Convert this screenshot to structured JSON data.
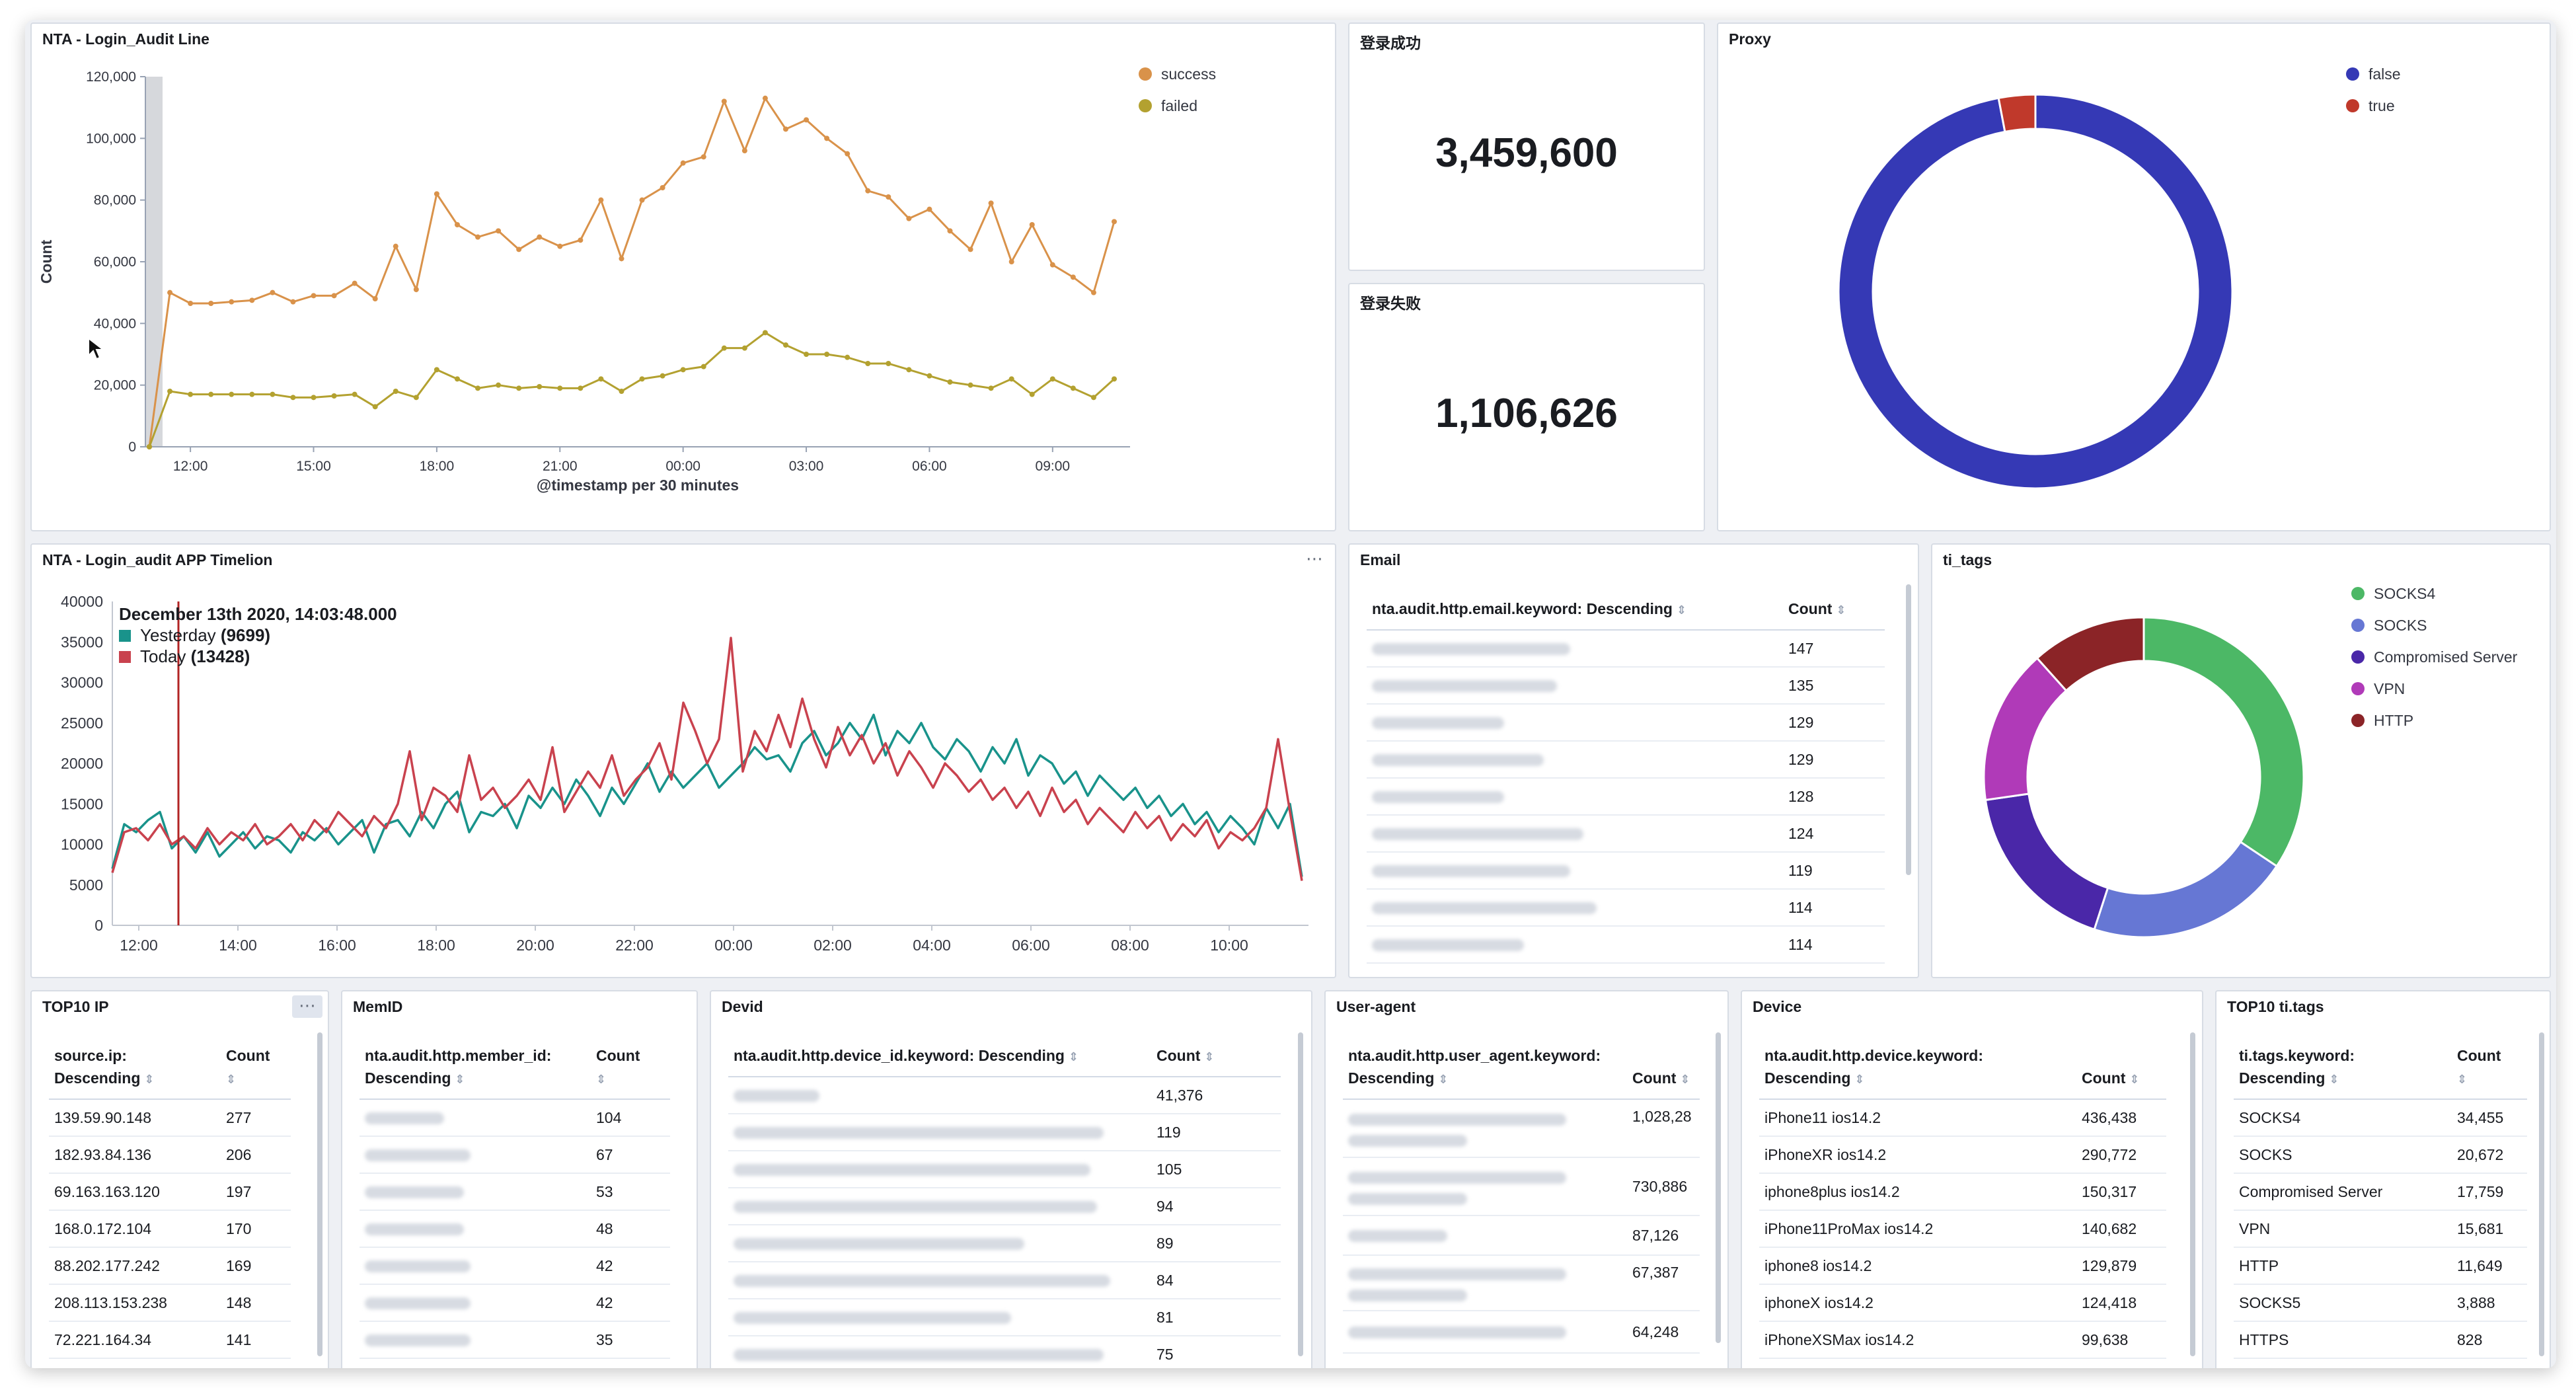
{
  "panels": {
    "login_line": {
      "title": "NTA - Login_Audit Line",
      "xlabel": "@timestamp per 30 minutes",
      "ylabel": "Count",
      "legend": [
        {
          "name": "success",
          "color": "#d9924a"
        },
        {
          "name": "failed",
          "color": "#b3a130"
        }
      ]
    },
    "success_metric": {
      "title": "登录成功",
      "value": "3,459,600"
    },
    "failed_metric": {
      "title": "登录失败",
      "value": "1,106,626"
    },
    "proxy": {
      "title": "Proxy",
      "legend": [
        {
          "name": "false",
          "color": "#3539b5"
        },
        {
          "name": "true",
          "color": "#c0392b"
        }
      ]
    },
    "timelion": {
      "title": "NTA - Login_audit APP Timelion",
      "tooltip": {
        "date": "December 13th 2020, 14:03:48.000",
        "rows": [
          {
            "label": "Yesterday",
            "value": "(9699)",
            "color": "#19938b"
          },
          {
            "label": "Today",
            "value": "(13428)",
            "color": "#c9424e"
          }
        ]
      }
    },
    "email": {
      "title": "Email",
      "col1": "nta.audit.http.email.keyword: Descending",
      "col2": "Count",
      "rows": [
        {
          "count": "147"
        },
        {
          "count": "135"
        },
        {
          "count": "129"
        },
        {
          "count": "129"
        },
        {
          "count": "128"
        },
        {
          "count": "124"
        },
        {
          "count": "119"
        },
        {
          "count": "114"
        },
        {
          "count": "114"
        }
      ]
    },
    "ti_tags": {
      "title": "ti_tags",
      "legend": [
        {
          "name": "SOCKS4",
          "color": "#4cb866"
        },
        {
          "name": "SOCKS",
          "color": "#6677d4"
        },
        {
          "name": "Compromised Server",
          "color": "#4a27a8"
        },
        {
          "name": "VPN",
          "color": "#b03ab8"
        },
        {
          "name": "HTTP",
          "color": "#8b2427"
        }
      ]
    },
    "top10_ip": {
      "title": "TOP10 IP",
      "col1": "source.ip: Descending",
      "col2": "Count",
      "rows": [
        {
          "key": "139.59.90.148",
          "count": "277"
        },
        {
          "key": "182.93.84.136",
          "count": "206"
        },
        {
          "key": "69.163.163.120",
          "count": "197"
        },
        {
          "key": "168.0.172.104",
          "count": "170"
        },
        {
          "key": "88.202.177.242",
          "count": "169"
        },
        {
          "key": "208.113.153.238",
          "count": "148"
        },
        {
          "key": "72.221.164.34",
          "count": "141"
        }
      ]
    },
    "memid": {
      "title": "MemID",
      "col1": "nta.audit.http.member_id: Descending",
      "col2": "Count",
      "rows": [
        {
          "count": "104"
        },
        {
          "count": "67"
        },
        {
          "count": "53"
        },
        {
          "count": "48"
        },
        {
          "count": "42"
        },
        {
          "count": "42"
        },
        {
          "count": "35"
        }
      ]
    },
    "devid": {
      "title": "Devid",
      "col1": "nta.audit.http.device_id.keyword: Descending",
      "col2": "Count",
      "rows": [
        {
          "count": "41,376"
        },
        {
          "count": "119"
        },
        {
          "count": "105"
        },
        {
          "count": "94"
        },
        {
          "count": "89"
        },
        {
          "count": "84"
        },
        {
          "count": "81"
        },
        {
          "count": "75"
        }
      ]
    },
    "useragent": {
      "title": "User-agent",
      "col1": "nta.audit.http.user_agent.keyword: Descending",
      "col2": "Count",
      "rows": [
        {
          "count": "1,028,28"
        },
        {
          "count": "730,886"
        },
        {
          "count": "87,126"
        },
        {
          "count": "67,387"
        },
        {
          "count": "64,248"
        }
      ]
    },
    "device": {
      "title": "Device",
      "col1": "nta.audit.http.device.keyword: Descending",
      "col2": "Count",
      "rows": [
        {
          "key": "iPhone11 ios14.2",
          "count": "436,438"
        },
        {
          "key": "iPhoneXR ios14.2",
          "count": "290,772"
        },
        {
          "key": "iphone8plus ios14.2",
          "count": "150,317"
        },
        {
          "key": "iPhone11ProMax ios14.2",
          "count": "140,682"
        },
        {
          "key": "iphone8 ios14.2",
          "count": "129,879"
        },
        {
          "key": "iphoneX ios14.2",
          "count": "124,418"
        },
        {
          "key": "iPhoneXSMax ios14.2",
          "count": "99,638"
        }
      ]
    },
    "top10_tags": {
      "title": "TOP10 ti.tags",
      "col1": "ti.tags.keyword: Descending",
      "col2": "Count",
      "rows": [
        {
          "key": "SOCKS4",
          "count": "34,455"
        },
        {
          "key": "SOCKS",
          "count": "20,672"
        },
        {
          "key": "Compromised Server",
          "count": "17,759"
        },
        {
          "key": "VPN",
          "count": "15,681"
        },
        {
          "key": "HTTP",
          "count": "11,649"
        },
        {
          "key": "SOCKS5",
          "count": "3,888"
        },
        {
          "key": "HTTPS",
          "count": "828"
        }
      ]
    }
  },
  "chart_data": [
    {
      "type": "line",
      "title": "NTA - Login_Audit Line",
      "xlabel": "@timestamp per 30 minutes",
      "ylabel": "Count",
      "ylim": [
        0,
        120000
      ],
      "x_ticks": [
        "12:00",
        "15:00",
        "18:00",
        "21:00",
        "00:00",
        "03:00",
        "06:00",
        "09:00"
      ],
      "y_ticks": [
        "0",
        "20,000",
        "40,000",
        "60,000",
        "80,000",
        "100,000",
        "120,000"
      ],
      "series": [
        {
          "name": "success",
          "color": "#d9924a",
          "values": [
            0,
            50000,
            46500,
            46500,
            47000,
            47500,
            50000,
            47000,
            49000,
            49000,
            53000,
            48000,
            65000,
            51000,
            82000,
            72000,
            68000,
            70000,
            64000,
            68000,
            65000,
            67000,
            80000,
            61000,
            80000,
            84000,
            92000,
            94000,
            112000,
            96000,
            113000,
            103000,
            106000,
            100000,
            95000,
            83000,
            81000,
            74000,
            77000,
            70000,
            64000,
            79000,
            60000,
            72000,
            59000,
            55000,
            50000,
            73000
          ]
        },
        {
          "name": "failed",
          "color": "#b3a130",
          "values": [
            0,
            18000,
            17000,
            17000,
            17000,
            17000,
            17000,
            16000,
            16000,
            16500,
            17000,
            13000,
            18000,
            16000,
            25000,
            22000,
            19000,
            20000,
            19000,
            19500,
            19000,
            19000,
            22000,
            18000,
            22000,
            23000,
            25000,
            26000,
            32000,
            32000,
            37000,
            33000,
            30000,
            30000,
            29000,
            27000,
            27000,
            25000,
            23000,
            21000,
            20000,
            19000,
            22000,
            17000,
            22000,
            19000,
            16000,
            22000
          ]
        }
      ]
    },
    {
      "type": "pie",
      "title": "Proxy",
      "labels": [
        "false",
        "true"
      ],
      "values": [
        97,
        3
      ],
      "colors": [
        "#3539b5",
        "#c0392b"
      ]
    },
    {
      "type": "line",
      "title": "NTA - Login_audit APP Timelion",
      "ylim": [
        0,
        40000
      ],
      "x_ticks": [
        "12:00",
        "14:00",
        "16:00",
        "18:00",
        "20:00",
        "22:00",
        "00:00",
        "02:00",
        "04:00",
        "06:00",
        "08:00",
        "10:00"
      ],
      "y_ticks": [
        "0",
        "5000",
        "10000",
        "15000",
        "20000",
        "25000",
        "30000",
        "35000",
        "40000"
      ],
      "series": [
        {
          "name": "Yesterday",
          "color": "#19938b",
          "values": [
            7000,
            12500,
            11500,
            13000,
            14000,
            9500,
            11000,
            9000,
            11500,
            8500,
            10000,
            11500,
            9500,
            11000,
            10500,
            9000,
            11500,
            10500,
            12000,
            10000,
            11500,
            13000,
            9000,
            12500,
            13000,
            11000,
            14000,
            12000,
            15000,
            16500,
            11500,
            14000,
            13500,
            15000,
            12000,
            16000,
            14500,
            17000,
            15000,
            18000,
            16000,
            13500,
            17000,
            15000,
            17500,
            20000,
            16500,
            19000,
            17000,
            18500,
            20000,
            17000,
            18500,
            20000,
            22000,
            20500,
            21000,
            19000,
            22500,
            24000,
            21000,
            22500,
            25000,
            23000,
            26000,
            21000,
            24000,
            22500,
            25000,
            22000,
            20500,
            23000,
            21500,
            19000,
            22000,
            20000,
            23000,
            18500,
            21000,
            20000,
            17500,
            19000,
            16000,
            18500,
            17000,
            15500,
            17000,
            14500,
            16000,
            13500,
            15000,
            12500,
            14000,
            11500,
            13500,
            12000,
            10000,
            14500,
            12000,
            15000,
            6000
          ]
        },
        {
          "name": "Today",
          "color": "#c9424e",
          "values": [
            6500,
            11500,
            12000,
            10500,
            12500,
            10000,
            11000,
            9500,
            12000,
            10000,
            11500,
            10500,
            12500,
            10000,
            11000,
            12500,
            10500,
            13000,
            11500,
            14000,
            12500,
            11000,
            13500,
            12000,
            15000,
            21500,
            13000,
            17000,
            16000,
            14000,
            21000,
            15500,
            17000,
            14500,
            16000,
            18000,
            15500,
            22000,
            14000,
            16500,
            19000,
            17000,
            21000,
            16000,
            18000,
            19500,
            22500,
            18000,
            27500,
            24000,
            20000,
            23000,
            35500,
            19000,
            24000,
            21500,
            26000,
            22000,
            28000,
            23000,
            19500,
            24500,
            21000,
            23500,
            20000,
            22500,
            18500,
            21500,
            19500,
            17000,
            20000,
            18500,
            16500,
            18000,
            15500,
            17000,
            14500,
            16500,
            13500,
            17000,
            14000,
            15500,
            12500,
            14500,
            13000,
            11500,
            14000,
            12000,
            13500,
            10500,
            12500,
            11000,
            13000,
            9500,
            11500,
            10500,
            12000,
            14500,
            23000,
            14000,
            5500
          ]
        }
      ]
    },
    {
      "type": "pie",
      "title": "ti_tags",
      "labels": [
        "SOCKS4",
        "SOCKS",
        "Compromised Server",
        "VPN",
        "HTTP"
      ],
      "values": [
        34455,
        20672,
        17759,
        15681,
        11649
      ],
      "colors": [
        "#4cb866",
        "#6677d4",
        "#4a27a8",
        "#b03ab8",
        "#8b2427"
      ]
    }
  ]
}
